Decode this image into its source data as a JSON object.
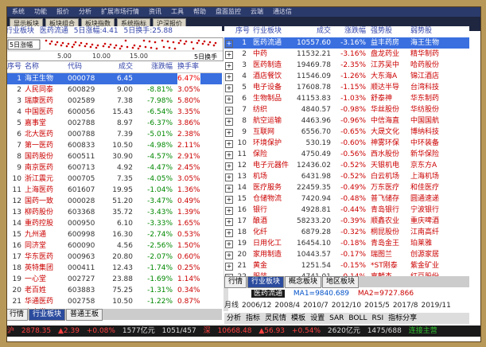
{
  "menu": [
    "系统",
    "功能",
    "报价",
    "分析",
    "扩展市场行情",
    "资讯",
    "工具",
    "帮助",
    "盘面监控",
    "云端",
    "通达信"
  ],
  "toolbar": [
    "显示板块",
    "板块组合",
    "板块指数",
    "系统指标",
    "沪深报价"
  ],
  "index": {
    "name": "行业板块",
    "sector": "医药流通",
    "amt5": "5日涨幅:4.41",
    "turn5": "5日换手:25.88",
    "spark_label": "5日涨幅",
    "scale": [
      "5.00",
      "10.00",
      "15.00"
    ],
    "right_label": "5日换手"
  },
  "left_headers": [
    "序号",
    "名称",
    "代码",
    "成交",
    "涨跌幅",
    "换手率"
  ],
  "left_rows": [
    [
      "1",
      "海王生物",
      "000078",
      "6.45",
      "",
      "6.47%"
    ],
    [
      "2",
      "人民同泰",
      "600829",
      "9.00",
      "-8.81%",
      "3.05%"
    ],
    [
      "3",
      "瑞康医药",
      "002589",
      "7.38",
      "-7.98%",
      "5.80%"
    ],
    [
      "4",
      "中国医药",
      "600056",
      "15.43",
      "-6.54%",
      "3.35%"
    ],
    [
      "5",
      "嘉事堂",
      "002788",
      "8.97",
      "-6.37%",
      "3.86%"
    ],
    [
      "6",
      "北大医药",
      "000788",
      "7.39",
      "-5.01%",
      "2.38%"
    ],
    [
      "7",
      "第一医药",
      "600833",
      "10.50",
      "-4.98%",
      "2.11%"
    ],
    [
      "8",
      "国药股份",
      "600511",
      "30.90",
      "-4.57%",
      "2.91%"
    ],
    [
      "9",
      "南京医药",
      "600713",
      "4.92",
      "-4.47%",
      "2.45%"
    ],
    [
      "10",
      "浙江震元",
      "000705",
      "7.35",
      "-4.05%",
      "3.05%"
    ],
    [
      "11",
      "上海医药",
      "601607",
      "19.95",
      "-1.04%",
      "1.36%"
    ],
    [
      "12",
      "国药一致",
      "000028",
      "51.20",
      "-3.47%",
      "0.49%"
    ],
    [
      "13",
      "柳药股份",
      "603368",
      "35.72",
      "-3.43%",
      "1.39%"
    ],
    [
      "14",
      "重药控股",
      "000950",
      "6.10",
      "-3.33%",
      "1.65%"
    ],
    [
      "15",
      "九州通",
      "600998",
      "16.30",
      "-2.74%",
      "0.53%"
    ],
    [
      "16",
      "同济堂",
      "600090",
      "4.56",
      "-2.56%",
      "1.50%"
    ],
    [
      "17",
      "华东医药",
      "000963",
      "20.80",
      "-2.07%",
      "0.60%"
    ],
    [
      "18",
      "英特集团",
      "000411",
      "12.43",
      "-1.74%",
      "0.25%"
    ],
    [
      "19",
      "一心堂",
      "002727",
      "23.88",
      "-1.69%",
      "1.14%"
    ],
    [
      "20",
      "老百姓",
      "603883",
      "75.25",
      "-1.31%",
      "0.34%"
    ],
    [
      "21",
      "华通医药",
      "002758",
      "10.50",
      "-1.22%",
      "0.87%"
    ],
    [
      "22",
      "嘉事堂",
      "002462",
      "16.00",
      "-1.17%",
      "0.84%"
    ]
  ],
  "left_tabs": [
    "行情",
    "行业板块",
    "普通王板"
  ],
  "right_headers": [
    "序号",
    "行业板块",
    "成交",
    "涨跌幅",
    "强势股",
    "弱势股"
  ],
  "right_rows": [
    [
      "1",
      "医药流通",
      "10557.60",
      "-3.16%",
      "益丰药房",
      "海王生物"
    ],
    [
      "2",
      "中药",
      "11532.21",
      "-3.16%",
      "盘龙药业",
      "精华制药"
    ],
    [
      "3",
      "医药制造",
      "19469.78",
      "-2.35%",
      "江苏吴中",
      "哈药股份"
    ],
    [
      "4",
      "酒店餐饮",
      "11546.09",
      "-1.26%",
      "大东海A",
      "锦江酒店"
    ],
    [
      "5",
      "电子设备",
      "17608.78",
      "-1.15%",
      "顺达半导",
      "台湾科技"
    ],
    [
      "6",
      "生物制品",
      "41153.83",
      "-1.03%",
      "舒泰神",
      "华东制药"
    ],
    [
      "7",
      "纺织",
      "4840.57",
      "-0.98%",
      "华丝股份",
      "华纺股份"
    ],
    [
      "8",
      "航空运输",
      "4463.96",
      "-0.96%",
      "中信海直",
      "中国国航"
    ],
    [
      "9",
      "互联网",
      "6556.70",
      "-0.65%",
      "大晟文化",
      "博纳科技"
    ],
    [
      "10",
      "环境保护",
      "530.19",
      "-0.60%",
      "神雾环保",
      "中环装备"
    ],
    [
      "11",
      "保险",
      "4750.49",
      "-0.56%",
      "西水股份",
      "新华保险"
    ],
    [
      "12",
      "电子元器件",
      "12436.02",
      "-0.52%",
      "天银机电",
      "京东方A"
    ],
    [
      "13",
      "机场",
      "6431.98",
      "-0.52%",
      "白云机场",
      "上海机场"
    ],
    [
      "14",
      "医疗服务",
      "22459.35",
      "-0.49%",
      "万东医疗",
      "和佳医疗"
    ],
    [
      "15",
      "仓储物流",
      "7420.94",
      "-0.48%",
      "普飞储存",
      "圆通速递"
    ],
    [
      "16",
      "银行",
      "4928.81",
      "-0.44%",
      "青岛银行",
      "宁波银行"
    ],
    [
      "17",
      "酿酒",
      "58233.20",
      "-0.39%",
      "顺鑫农业",
      "重庆啤酒"
    ],
    [
      "18",
      "化纤",
      "6879.28",
      "-0.32%",
      "桐昆股份",
      "江南高纤"
    ],
    [
      "19",
      "日用化工",
      "16454.10",
      "-0.18%",
      "青岛金王",
      "珀莱雅"
    ],
    [
      "20",
      "家用制造",
      "10443.57",
      "-0.17%",
      "瑞图兰",
      "创源家居"
    ],
    [
      "21",
      "黄金",
      "1251.54",
      "-0.15%",
      "*ST刚泰",
      "紫金矿业"
    ],
    [
      "22",
      "服装",
      "4741.01",
      "-0.14%",
      "嘉麟杰",
      "红豆股份"
    ]
  ],
  "right_tabs": [
    "行情",
    "行业板块",
    "概念板块",
    "地区板块"
  ],
  "info": {
    "sector": "医药流通",
    "ma1": "MA1=9840.689",
    "ma2": "MA2=9727.866"
  },
  "dates": [
    "月线",
    "2006/12",
    "2008/4",
    "2010/7",
    "2012/10",
    "2015/5",
    "2017/8",
    "2019/11"
  ],
  "right_bottom": [
    "分析",
    "指标",
    "灵民情",
    "模板",
    "设置",
    "SAR",
    "BOLL",
    "RSI",
    "指标分享"
  ],
  "status": {
    "sh_label": "沪",
    "sh_val": "2878.35",
    "sh_chg": "▲2.39",
    "sh_pct": "+0.08%",
    "sh_amt": "1577亿元",
    "sz_val": "1051/457",
    "sz2_label": "深",
    "sz2_val": "10668.48",
    "sz2_chg": "▲56.93",
    "sz2_pct": "+0.54%",
    "sz2_amt": "2620亿元",
    "sz2_ratio": "1475/688",
    "conn": "连接主营"
  }
}
